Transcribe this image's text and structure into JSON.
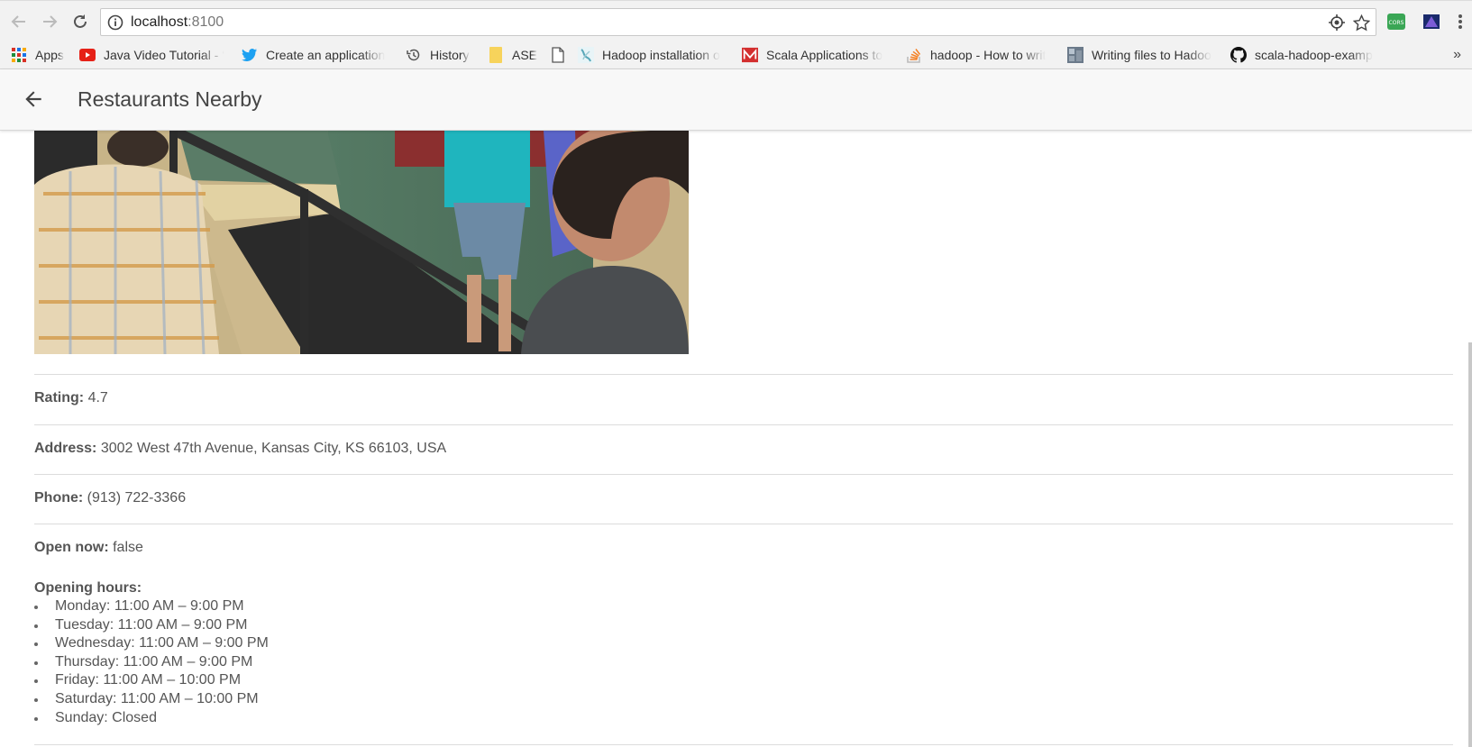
{
  "browser": {
    "url_host": "localhost",
    "url_port": ":8100",
    "icons": {
      "back": "arrow-back-icon",
      "forward": "arrow-forward-icon",
      "reload": "reload-icon",
      "info": "info-icon",
      "location": "location-icon",
      "star": "star-icon",
      "menu": "kebab-menu-icon"
    },
    "extensions": [
      "CORS"
    ],
    "bookmarks": [
      {
        "label": "Apps",
        "icon": "apps-grid-icon"
      },
      {
        "label": "Java Video Tutorial - ‘",
        "icon": "youtube-icon"
      },
      {
        "label": "Create an application",
        "icon": "twitter-icon"
      },
      {
        "label": "History",
        "icon": "history-icon"
      },
      {
        "label": "ASE",
        "icon": "folder-icon"
      },
      {
        "label": "",
        "icon": "page-icon"
      },
      {
        "label": "Hadoop installation o",
        "icon": "hadoop-icon"
      },
      {
        "label": "Scala Applications to",
        "icon": "medium-icon"
      },
      {
        "label": "hadoop - How to writ",
        "icon": "stackoverflow-icon"
      },
      {
        "label": "Writing files to Hadoo",
        "icon": "image-icon"
      },
      {
        "label": "scala-hadoop-examp",
        "icon": "github-icon"
      }
    ],
    "more_bookmarks": "»"
  },
  "header": {
    "title": "Restaurants Nearby",
    "back_icon": "arrow-back-icon"
  },
  "details": {
    "rating_label": "Rating:",
    "rating_value": "4.7",
    "address_label": "Address:",
    "address_value": "3002 West 47th Avenue, Kansas City, KS 66103, USA",
    "phone_label": "Phone:",
    "phone_value": "(913) 722-3366",
    "open_now_label": "Open now:",
    "open_now_value": "false",
    "hours_label": "Opening hours:",
    "hours": [
      "Monday: 11:00 AM – 9:00 PM",
      "Tuesday: 11:00 AM – 9:00 PM",
      "Wednesday: 11:00 AM – 9:00 PM",
      "Thursday: 11:00 AM – 9:00 PM",
      "Friday: 11:00 AM – 10:00 PM",
      "Saturday: 11:00 AM – 10:00 PM",
      "Sunday: Closed"
    ]
  }
}
